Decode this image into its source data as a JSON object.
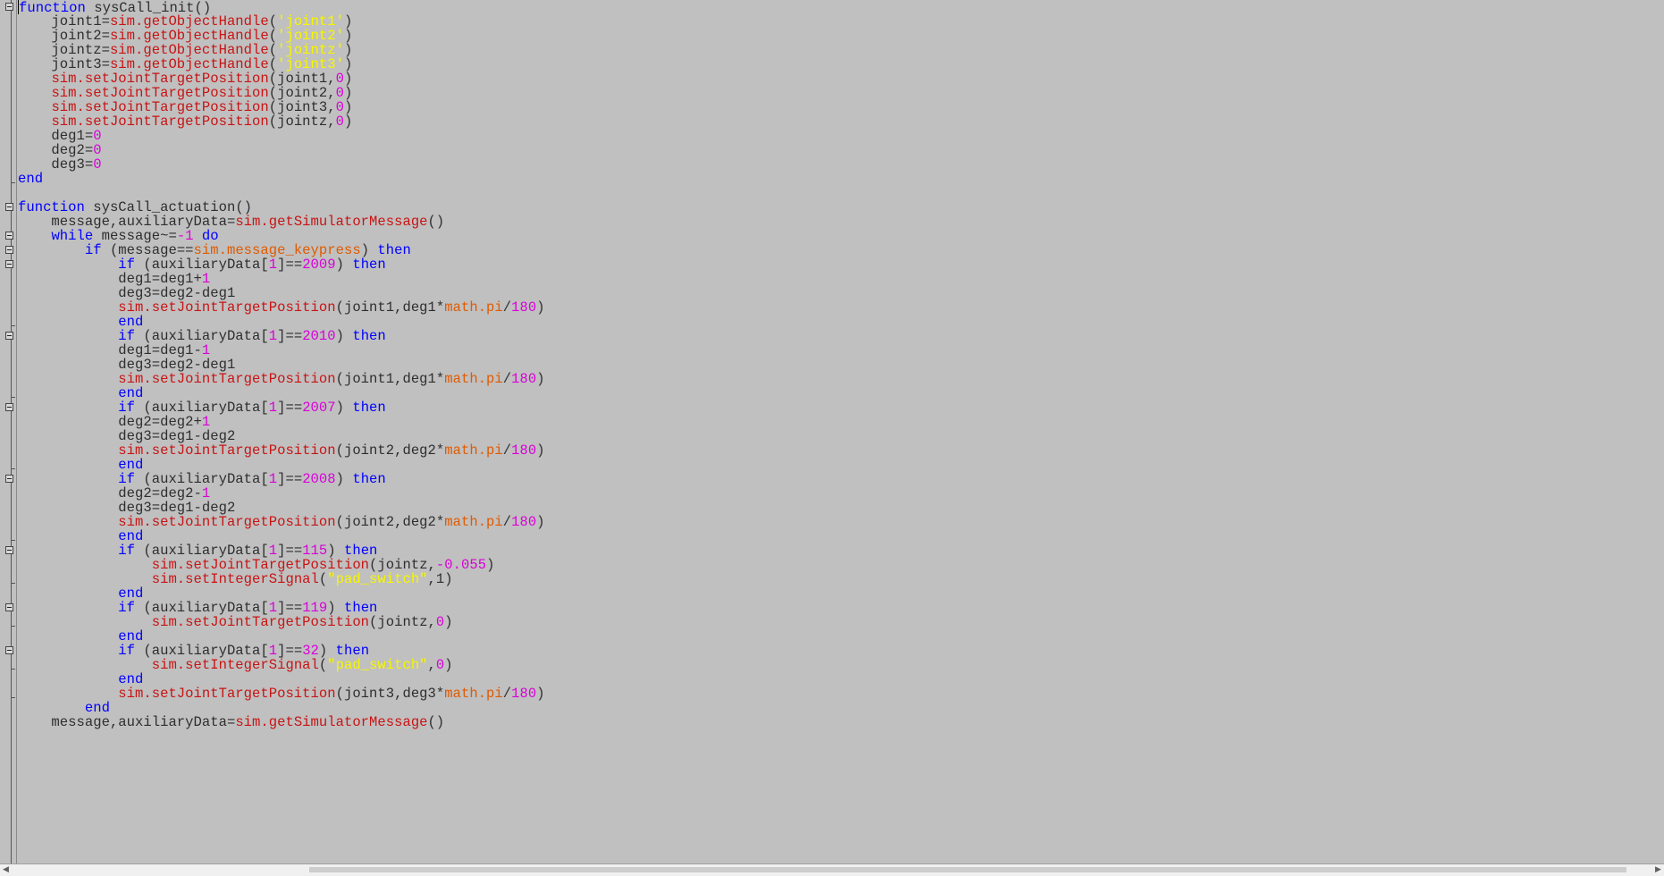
{
  "editor": {
    "lines": [
      [
        {
          "t": "function",
          "c": "kw"
        },
        {
          "t": " sysCall_init()",
          "c": "plain"
        }
      ],
      [
        {
          "t": "    joint1=",
          "c": "plain"
        },
        {
          "t": "sim.getObjectHandle",
          "c": "api"
        },
        {
          "t": "(",
          "c": "plain"
        },
        {
          "t": "'joint1'",
          "c": "str"
        },
        {
          "t": ")",
          "c": "plain"
        }
      ],
      [
        {
          "t": "    joint2=",
          "c": "plain"
        },
        {
          "t": "sim.getObjectHandle",
          "c": "api"
        },
        {
          "t": "(",
          "c": "plain"
        },
        {
          "t": "'joint2'",
          "c": "str"
        },
        {
          "t": ")",
          "c": "plain"
        }
      ],
      [
        {
          "t": "    jointz=",
          "c": "plain"
        },
        {
          "t": "sim.getObjectHandle",
          "c": "api"
        },
        {
          "t": "(",
          "c": "plain"
        },
        {
          "t": "'jointz'",
          "c": "str"
        },
        {
          "t": ")",
          "c": "plain"
        }
      ],
      [
        {
          "t": "    joint3=",
          "c": "plain"
        },
        {
          "t": "sim.getObjectHandle",
          "c": "api"
        },
        {
          "t": "(",
          "c": "plain"
        },
        {
          "t": "'joint3'",
          "c": "str"
        },
        {
          "t": ")",
          "c": "plain"
        }
      ],
      [
        {
          "t": "    ",
          "c": "plain"
        },
        {
          "t": "sim.setJointTargetPosition",
          "c": "api"
        },
        {
          "t": "(joint1,",
          "c": "plain"
        },
        {
          "t": "0",
          "c": "num"
        },
        {
          "t": ")",
          "c": "plain"
        }
      ],
      [
        {
          "t": "    ",
          "c": "plain"
        },
        {
          "t": "sim.setJointTargetPosition",
          "c": "api"
        },
        {
          "t": "(joint2,",
          "c": "plain"
        },
        {
          "t": "0",
          "c": "num"
        },
        {
          "t": ")",
          "c": "plain"
        }
      ],
      [
        {
          "t": "    ",
          "c": "plain"
        },
        {
          "t": "sim.setJointTargetPosition",
          "c": "api"
        },
        {
          "t": "(joint3,",
          "c": "plain"
        },
        {
          "t": "0",
          "c": "num"
        },
        {
          "t": ")",
          "c": "plain"
        }
      ],
      [
        {
          "t": "    ",
          "c": "plain"
        },
        {
          "t": "sim.setJointTargetPosition",
          "c": "api"
        },
        {
          "t": "(jointz,",
          "c": "plain"
        },
        {
          "t": "0",
          "c": "num"
        },
        {
          "t": ")",
          "c": "plain"
        }
      ],
      [
        {
          "t": "    deg1=",
          "c": "plain"
        },
        {
          "t": "0",
          "c": "num"
        }
      ],
      [
        {
          "t": "    deg2=",
          "c": "plain"
        },
        {
          "t": "0",
          "c": "num"
        }
      ],
      [
        {
          "t": "    deg3=",
          "c": "plain"
        },
        {
          "t": "0",
          "c": "num"
        }
      ],
      [
        {
          "t": "end",
          "c": "kw"
        }
      ],
      [
        {
          "t": "",
          "c": "plain"
        }
      ],
      [
        {
          "t": "function",
          "c": "kw"
        },
        {
          "t": " sysCall_actuation()",
          "c": "plain"
        }
      ],
      [
        {
          "t": "    message,auxiliaryData=",
          "c": "plain"
        },
        {
          "t": "sim.getSimulatorMessage",
          "c": "api"
        },
        {
          "t": "()",
          "c": "plain"
        }
      ],
      [
        {
          "t": "    ",
          "c": "plain"
        },
        {
          "t": "while",
          "c": "kw"
        },
        {
          "t": " message~=",
          "c": "plain"
        },
        {
          "t": "-1",
          "c": "num"
        },
        {
          "t": " ",
          "c": "plain"
        },
        {
          "t": "do",
          "c": "kw"
        }
      ],
      [
        {
          "t": "        ",
          "c": "plain"
        },
        {
          "t": "if",
          "c": "kw"
        },
        {
          "t": " (message==",
          "c": "plain"
        },
        {
          "t": "sim.message_keypress",
          "c": "const"
        },
        {
          "t": ") ",
          "c": "plain"
        },
        {
          "t": "then",
          "c": "kw"
        }
      ],
      [
        {
          "t": "            ",
          "c": "plain"
        },
        {
          "t": "if",
          "c": "kw"
        },
        {
          "t": " (auxiliaryData[",
          "c": "plain"
        },
        {
          "t": "1",
          "c": "num"
        },
        {
          "t": "]==",
          "c": "plain"
        },
        {
          "t": "2009",
          "c": "num"
        },
        {
          "t": ") ",
          "c": "plain"
        },
        {
          "t": "then",
          "c": "kw"
        }
      ],
      [
        {
          "t": "            deg1=deg1+",
          "c": "plain"
        },
        {
          "t": "1",
          "c": "num"
        }
      ],
      [
        {
          "t": "            deg3=deg2-deg1",
          "c": "plain"
        }
      ],
      [
        {
          "t": "            ",
          "c": "plain"
        },
        {
          "t": "sim.setJointTargetPosition",
          "c": "api"
        },
        {
          "t": "(joint1,deg1*",
          "c": "plain"
        },
        {
          "t": "math.pi",
          "c": "const"
        },
        {
          "t": "/",
          "c": "plain"
        },
        {
          "t": "180",
          "c": "num"
        },
        {
          "t": ")",
          "c": "plain"
        }
      ],
      [
        {
          "t": "            ",
          "c": "plain"
        },
        {
          "t": "end",
          "c": "kw"
        }
      ],
      [
        {
          "t": "            ",
          "c": "plain"
        },
        {
          "t": "if",
          "c": "kw"
        },
        {
          "t": " (auxiliaryData[",
          "c": "plain"
        },
        {
          "t": "1",
          "c": "num"
        },
        {
          "t": "]==",
          "c": "plain"
        },
        {
          "t": "2010",
          "c": "num"
        },
        {
          "t": ") ",
          "c": "plain"
        },
        {
          "t": "then",
          "c": "kw"
        }
      ],
      [
        {
          "t": "            deg1=deg1-",
          "c": "plain"
        },
        {
          "t": "1",
          "c": "num"
        }
      ],
      [
        {
          "t": "            deg3=deg2-deg1",
          "c": "plain"
        }
      ],
      [
        {
          "t": "            ",
          "c": "plain"
        },
        {
          "t": "sim.setJointTargetPosition",
          "c": "api"
        },
        {
          "t": "(joint1,deg1*",
          "c": "plain"
        },
        {
          "t": "math.pi",
          "c": "const"
        },
        {
          "t": "/",
          "c": "plain"
        },
        {
          "t": "180",
          "c": "num"
        },
        {
          "t": ")",
          "c": "plain"
        }
      ],
      [
        {
          "t": "            ",
          "c": "plain"
        },
        {
          "t": "end",
          "c": "kw"
        }
      ],
      [
        {
          "t": "            ",
          "c": "plain"
        },
        {
          "t": "if",
          "c": "kw"
        },
        {
          "t": " (auxiliaryData[",
          "c": "plain"
        },
        {
          "t": "1",
          "c": "num"
        },
        {
          "t": "]==",
          "c": "plain"
        },
        {
          "t": "2007",
          "c": "num"
        },
        {
          "t": ") ",
          "c": "plain"
        },
        {
          "t": "then",
          "c": "kw"
        }
      ],
      [
        {
          "t": "            deg2=deg2+",
          "c": "plain"
        },
        {
          "t": "1",
          "c": "num"
        }
      ],
      [
        {
          "t": "            deg3=deg1-deg2",
          "c": "plain"
        }
      ],
      [
        {
          "t": "            ",
          "c": "plain"
        },
        {
          "t": "sim.setJointTargetPosition",
          "c": "api"
        },
        {
          "t": "(joint2,deg2*",
          "c": "plain"
        },
        {
          "t": "math.pi",
          "c": "const"
        },
        {
          "t": "/",
          "c": "plain"
        },
        {
          "t": "180",
          "c": "num"
        },
        {
          "t": ")",
          "c": "plain"
        }
      ],
      [
        {
          "t": "            ",
          "c": "plain"
        },
        {
          "t": "end",
          "c": "kw"
        }
      ],
      [
        {
          "t": "            ",
          "c": "plain"
        },
        {
          "t": "if",
          "c": "kw"
        },
        {
          "t": " (auxiliaryData[",
          "c": "plain"
        },
        {
          "t": "1",
          "c": "num"
        },
        {
          "t": "]==",
          "c": "plain"
        },
        {
          "t": "2008",
          "c": "num"
        },
        {
          "t": ") ",
          "c": "plain"
        },
        {
          "t": "then",
          "c": "kw"
        }
      ],
      [
        {
          "t": "            deg2=deg2-",
          "c": "plain"
        },
        {
          "t": "1",
          "c": "num"
        }
      ],
      [
        {
          "t": "            deg3=deg1-deg2",
          "c": "plain"
        }
      ],
      [
        {
          "t": "            ",
          "c": "plain"
        },
        {
          "t": "sim.setJointTargetPosition",
          "c": "api"
        },
        {
          "t": "(joint2,deg2*",
          "c": "plain"
        },
        {
          "t": "math.pi",
          "c": "const"
        },
        {
          "t": "/",
          "c": "plain"
        },
        {
          "t": "180",
          "c": "num"
        },
        {
          "t": ")",
          "c": "plain"
        }
      ],
      [
        {
          "t": "            ",
          "c": "plain"
        },
        {
          "t": "end",
          "c": "kw"
        }
      ],
      [
        {
          "t": "            ",
          "c": "plain"
        },
        {
          "t": "if",
          "c": "kw"
        },
        {
          "t": " (auxiliaryData[",
          "c": "plain"
        },
        {
          "t": "1",
          "c": "num"
        },
        {
          "t": "]==",
          "c": "plain"
        },
        {
          "t": "115",
          "c": "num"
        },
        {
          "t": ") ",
          "c": "plain"
        },
        {
          "t": "then",
          "c": "kw"
        }
      ],
      [
        {
          "t": "                ",
          "c": "plain"
        },
        {
          "t": "sim.setJointTargetPosition",
          "c": "api"
        },
        {
          "t": "(jointz,",
          "c": "plain"
        },
        {
          "t": "-0.055",
          "c": "num"
        },
        {
          "t": ")",
          "c": "plain"
        }
      ],
      [
        {
          "t": "                ",
          "c": "plain"
        },
        {
          "t": "sim.setIntegerSignal",
          "c": "api"
        },
        {
          "t": "(",
          "c": "plain"
        },
        {
          "t": "\"pad_switch\"",
          "c": "str"
        },
        {
          "t": ",1)",
          "c": "plain"
        }
      ],
      [
        {
          "t": "            ",
          "c": "plain"
        },
        {
          "t": "end",
          "c": "kw"
        }
      ],
      [
        {
          "t": "            ",
          "c": "plain"
        },
        {
          "t": "if",
          "c": "kw"
        },
        {
          "t": " (auxiliaryData[",
          "c": "plain"
        },
        {
          "t": "1",
          "c": "num"
        },
        {
          "t": "]==",
          "c": "plain"
        },
        {
          "t": "119",
          "c": "num"
        },
        {
          "t": ") ",
          "c": "plain"
        },
        {
          "t": "then",
          "c": "kw"
        }
      ],
      [
        {
          "t": "                ",
          "c": "plain"
        },
        {
          "t": "sim.setJointTargetPosition",
          "c": "api"
        },
        {
          "t": "(jointz,",
          "c": "plain"
        },
        {
          "t": "0",
          "c": "num"
        },
        {
          "t": ")",
          "c": "plain"
        }
      ],
      [
        {
          "t": "            ",
          "c": "plain"
        },
        {
          "t": "end",
          "c": "kw"
        }
      ],
      [
        {
          "t": "            ",
          "c": "plain"
        },
        {
          "t": "if",
          "c": "kw"
        },
        {
          "t": " (auxiliaryData[",
          "c": "plain"
        },
        {
          "t": "1",
          "c": "num"
        },
        {
          "t": "]==",
          "c": "plain"
        },
        {
          "t": "32",
          "c": "num"
        },
        {
          "t": ") ",
          "c": "plain"
        },
        {
          "t": "then",
          "c": "kw"
        }
      ],
      [
        {
          "t": "                ",
          "c": "plain"
        },
        {
          "t": "sim.setIntegerSignal",
          "c": "api"
        },
        {
          "t": "(",
          "c": "plain"
        },
        {
          "t": "\"pad_switch\"",
          "c": "str"
        },
        {
          "t": ",",
          "c": "plain"
        },
        {
          "t": "0",
          "c": "num"
        },
        {
          "t": ")",
          "c": "plain"
        }
      ],
      [
        {
          "t": "            ",
          "c": "plain"
        },
        {
          "t": "end",
          "c": "kw"
        }
      ],
      [
        {
          "t": "            ",
          "c": "plain"
        },
        {
          "t": "sim.setJointTargetPosition",
          "c": "api"
        },
        {
          "t": "(joint3,deg3*",
          "c": "plain"
        },
        {
          "t": "math.pi",
          "c": "const"
        },
        {
          "t": "/",
          "c": "plain"
        },
        {
          "t": "180",
          "c": "num"
        },
        {
          "t": ")",
          "c": "plain"
        }
      ],
      [
        {
          "t": "        ",
          "c": "plain"
        },
        {
          "t": "end",
          "c": "kw"
        }
      ],
      [
        {
          "t": "    message,auxiliaryData=",
          "c": "plain"
        },
        {
          "t": "sim.getSimulatorMessage",
          "c": "api"
        },
        {
          "t": "()",
          "c": "plain"
        }
      ]
    ],
    "fold_markers": [
      0,
      14,
      16,
      17,
      18,
      23,
      28,
      33,
      38,
      42,
      45
    ],
    "fold_ends": [
      12,
      22,
      27,
      32,
      37,
      40,
      43,
      46,
      48
    ],
    "caret_line": 0
  },
  "colors": {
    "background": "#c0c0c0",
    "keyword": "#0000ff",
    "api_function": "#c81414",
    "constant": "#e05a00",
    "number": "#d800d8",
    "string": "#f6f600",
    "plain": "#2e2e2e"
  },
  "icons": {
    "fold": "fold-collapse-icon",
    "scroll_left": "scroll-left-arrow-icon",
    "scroll_right": "scroll-right-arrow-icon"
  }
}
